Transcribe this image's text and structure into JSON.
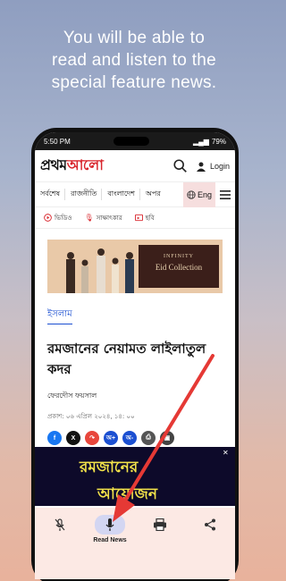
{
  "promo": {
    "line1": "You will be able to",
    "line2": "read and listen to the",
    "line3": "special feature news."
  },
  "status_bar": {
    "time": "5:50 PM",
    "battery": "79%"
  },
  "app_header": {
    "logo": "প্রথম আলো",
    "login_label": "Login"
  },
  "nav": {
    "items": [
      "সর্বশেষ",
      "রাজনীতি",
      "বাংলাদেশ",
      "অপর"
    ],
    "language_label": "Eng"
  },
  "media_tabs": [
    {
      "label": "ভিডিও",
      "icon": "play-circle-icon"
    },
    {
      "label": "সাক্ষাৎকার",
      "icon": "mic-icon"
    },
    {
      "label": "ছবি",
      "icon": "photo-icon"
    }
  ],
  "advertisement": {
    "brand": "INFINITY",
    "tagline": "Eid Collection"
  },
  "article": {
    "category": "ইসলাম",
    "title": "রমজানের নেয়ামত লাইলাতুল কদর",
    "author": "ফেরদৌস ফয়সাল",
    "published": "প্রকাশ: ০৬ এপ্রিল ২০২৪, ১৪: ০০"
  },
  "share_buttons": [
    {
      "name": "facebook",
      "glyph": "f",
      "color": "#1877f2"
    },
    {
      "name": "x",
      "glyph": "X",
      "color": "#111111"
    },
    {
      "name": "share",
      "glyph": "↷",
      "color": "#e8463c"
    },
    {
      "name": "font-increase",
      "glyph": "অ+",
      "color": "#1b4fd1"
    },
    {
      "name": "font-decrease",
      "glyph": "অ-",
      "color": "#1b4fd1"
    },
    {
      "name": "print",
      "glyph": "⎙",
      "color": "#555555"
    },
    {
      "name": "bookmark",
      "glyph": "▣",
      "color": "#444444"
    }
  ],
  "banner": {
    "line1": "রমজানের",
    "line2": "আয়োজন"
  },
  "bottom_bar": {
    "items": [
      {
        "label": "",
        "icon": "mic-off-icon"
      },
      {
        "label": "Read News",
        "icon": "mic-icon",
        "active": true
      },
      {
        "label": "",
        "icon": "print-icon"
      },
      {
        "label": "",
        "icon": "share-icon"
      }
    ]
  },
  "colors": {
    "accent_red": "#d8232a",
    "link_blue": "#1b4fd1",
    "arrow_red": "#e53935",
    "bottom_bar_bg": "#fce9e4",
    "active_pill": "#d3d6f2"
  }
}
